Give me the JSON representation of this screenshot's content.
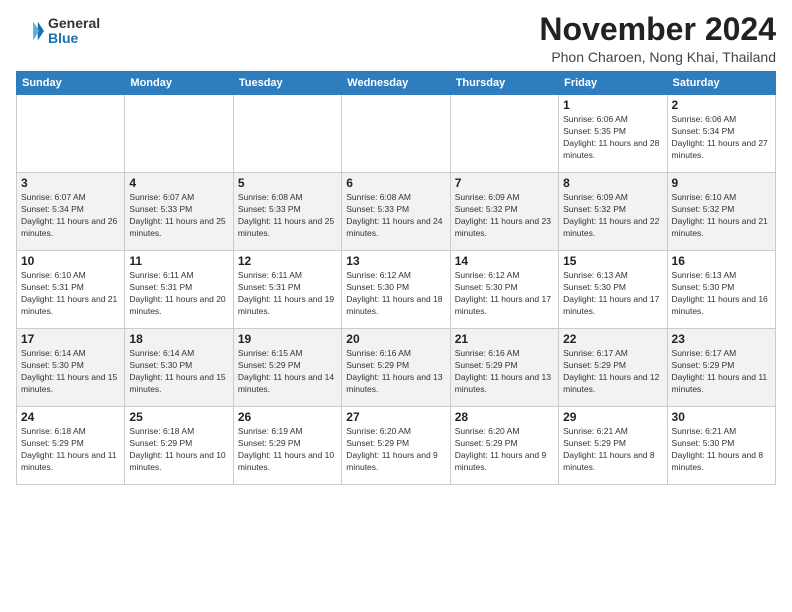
{
  "header": {
    "logo": {
      "general": "General",
      "blue": "Blue"
    },
    "title": "November 2024",
    "location": "Phon Charoen, Nong Khai, Thailand"
  },
  "calendar": {
    "weekdays": [
      "Sunday",
      "Monday",
      "Tuesday",
      "Wednesday",
      "Thursday",
      "Friday",
      "Saturday"
    ],
    "weeks": [
      [
        {
          "day": "",
          "info": ""
        },
        {
          "day": "",
          "info": ""
        },
        {
          "day": "",
          "info": ""
        },
        {
          "day": "",
          "info": ""
        },
        {
          "day": "",
          "info": ""
        },
        {
          "day": "1",
          "info": "Sunrise: 6:06 AM\nSunset: 5:35 PM\nDaylight: 11 hours and 28 minutes."
        },
        {
          "day": "2",
          "info": "Sunrise: 6:06 AM\nSunset: 5:34 PM\nDaylight: 11 hours and 27 minutes."
        }
      ],
      [
        {
          "day": "3",
          "info": "Sunrise: 6:07 AM\nSunset: 5:34 PM\nDaylight: 11 hours and 26 minutes."
        },
        {
          "day": "4",
          "info": "Sunrise: 6:07 AM\nSunset: 5:33 PM\nDaylight: 11 hours and 25 minutes."
        },
        {
          "day": "5",
          "info": "Sunrise: 6:08 AM\nSunset: 5:33 PM\nDaylight: 11 hours and 25 minutes."
        },
        {
          "day": "6",
          "info": "Sunrise: 6:08 AM\nSunset: 5:33 PM\nDaylight: 11 hours and 24 minutes."
        },
        {
          "day": "7",
          "info": "Sunrise: 6:09 AM\nSunset: 5:32 PM\nDaylight: 11 hours and 23 minutes."
        },
        {
          "day": "8",
          "info": "Sunrise: 6:09 AM\nSunset: 5:32 PM\nDaylight: 11 hours and 22 minutes."
        },
        {
          "day": "9",
          "info": "Sunrise: 6:10 AM\nSunset: 5:32 PM\nDaylight: 11 hours and 21 minutes."
        }
      ],
      [
        {
          "day": "10",
          "info": "Sunrise: 6:10 AM\nSunset: 5:31 PM\nDaylight: 11 hours and 21 minutes."
        },
        {
          "day": "11",
          "info": "Sunrise: 6:11 AM\nSunset: 5:31 PM\nDaylight: 11 hours and 20 minutes."
        },
        {
          "day": "12",
          "info": "Sunrise: 6:11 AM\nSunset: 5:31 PM\nDaylight: 11 hours and 19 minutes."
        },
        {
          "day": "13",
          "info": "Sunrise: 6:12 AM\nSunset: 5:30 PM\nDaylight: 11 hours and 18 minutes."
        },
        {
          "day": "14",
          "info": "Sunrise: 6:12 AM\nSunset: 5:30 PM\nDaylight: 11 hours and 17 minutes."
        },
        {
          "day": "15",
          "info": "Sunrise: 6:13 AM\nSunset: 5:30 PM\nDaylight: 11 hours and 17 minutes."
        },
        {
          "day": "16",
          "info": "Sunrise: 6:13 AM\nSunset: 5:30 PM\nDaylight: 11 hours and 16 minutes."
        }
      ],
      [
        {
          "day": "17",
          "info": "Sunrise: 6:14 AM\nSunset: 5:30 PM\nDaylight: 11 hours and 15 minutes."
        },
        {
          "day": "18",
          "info": "Sunrise: 6:14 AM\nSunset: 5:30 PM\nDaylight: 11 hours and 15 minutes."
        },
        {
          "day": "19",
          "info": "Sunrise: 6:15 AM\nSunset: 5:29 PM\nDaylight: 11 hours and 14 minutes."
        },
        {
          "day": "20",
          "info": "Sunrise: 6:16 AM\nSunset: 5:29 PM\nDaylight: 11 hours and 13 minutes."
        },
        {
          "day": "21",
          "info": "Sunrise: 6:16 AM\nSunset: 5:29 PM\nDaylight: 11 hours and 13 minutes."
        },
        {
          "day": "22",
          "info": "Sunrise: 6:17 AM\nSunset: 5:29 PM\nDaylight: 11 hours and 12 minutes."
        },
        {
          "day": "23",
          "info": "Sunrise: 6:17 AM\nSunset: 5:29 PM\nDaylight: 11 hours and 11 minutes."
        }
      ],
      [
        {
          "day": "24",
          "info": "Sunrise: 6:18 AM\nSunset: 5:29 PM\nDaylight: 11 hours and 11 minutes."
        },
        {
          "day": "25",
          "info": "Sunrise: 6:18 AM\nSunset: 5:29 PM\nDaylight: 11 hours and 10 minutes."
        },
        {
          "day": "26",
          "info": "Sunrise: 6:19 AM\nSunset: 5:29 PM\nDaylight: 11 hours and 10 minutes."
        },
        {
          "day": "27",
          "info": "Sunrise: 6:20 AM\nSunset: 5:29 PM\nDaylight: 11 hours and 9 minutes."
        },
        {
          "day": "28",
          "info": "Sunrise: 6:20 AM\nSunset: 5:29 PM\nDaylight: 11 hours and 9 minutes."
        },
        {
          "day": "29",
          "info": "Sunrise: 6:21 AM\nSunset: 5:29 PM\nDaylight: 11 hours and 8 minutes."
        },
        {
          "day": "30",
          "info": "Sunrise: 6:21 AM\nSunset: 5:30 PM\nDaylight: 11 hours and 8 minutes."
        }
      ]
    ]
  }
}
